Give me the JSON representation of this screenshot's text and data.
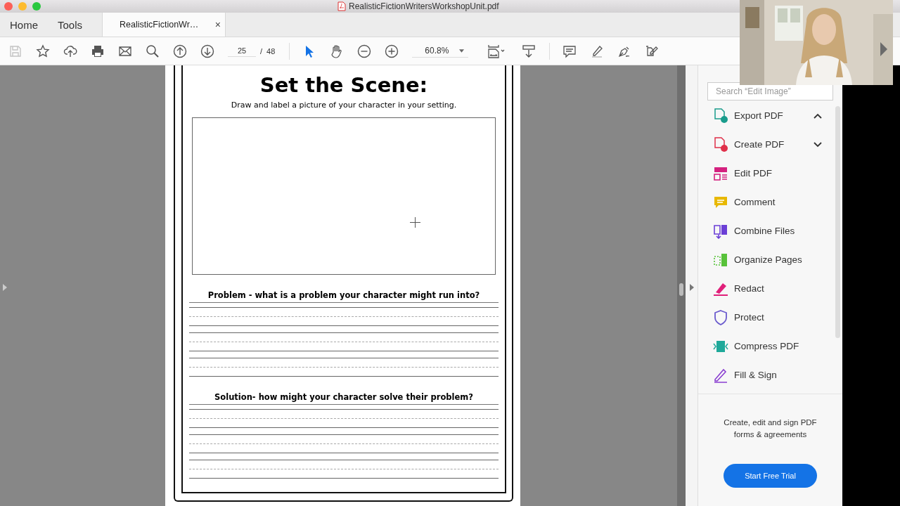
{
  "window": {
    "title": "RealisticFictionWritersWorkshopUnit.pdf"
  },
  "tabs": [
    {
      "label": "Home",
      "selected": false
    },
    {
      "label": "Tools",
      "selected": false
    },
    {
      "label": "RealisticFictionWr…",
      "selected": true,
      "close": "×"
    }
  ],
  "toolbar": {
    "file_tools": [
      {
        "kind": "save",
        "disabled": true
      },
      {
        "kind": "star",
        "disabled": false
      },
      {
        "kind": "upload",
        "disabled": false
      },
      {
        "kind": "print",
        "disabled": false
      },
      {
        "kind": "mail",
        "disabled": false
      },
      {
        "kind": "search",
        "disabled": false
      }
    ],
    "page_nav": {
      "current": "25",
      "separator": "/",
      "total": "48"
    },
    "view_tools": [
      {
        "kind": "pointer",
        "selected": true
      },
      {
        "kind": "hand",
        "selected": false
      },
      {
        "kind": "zoom-out",
        "selected": false
      },
      {
        "kind": "zoom-in",
        "selected": false
      }
    ],
    "zoom": "60.8%",
    "edit_tools": [
      {
        "kind": "fit"
      },
      {
        "kind": "scroll"
      },
      {
        "kind": "comment"
      },
      {
        "kind": "highlight"
      },
      {
        "kind": "sign"
      },
      {
        "kind": "share"
      }
    ]
  },
  "document": {
    "title": "Set the Scene:",
    "instruction": "Draw and label a picture of your character in your setting.",
    "sections": [
      {
        "heading": "**Problem** - what is a problem your character might run into?"
      },
      {
        "heading": "**Solution**- how might your character solve their problem?"
      }
    ]
  },
  "tools_panel": {
    "search": {
      "placeholder": "Search “Edit Image”"
    },
    "tools": [
      {
        "label": "Export PDF",
        "kind": "export",
        "color": "#1a9c8c",
        "expanded": true
      },
      {
        "label": "Create PDF",
        "kind": "create",
        "color": "#e0304a",
        "expanded": false
      },
      {
        "label": "Edit PDF",
        "kind": "edit",
        "color": "#d4217f"
      },
      {
        "label": "Comment",
        "kind": "comment",
        "color": "#e8b800"
      },
      {
        "label": "Combine Files",
        "kind": "combine",
        "color": "#6b3fd6"
      },
      {
        "label": "Organize Pages",
        "kind": "organize",
        "color": "#58c23a"
      },
      {
        "label": "Redact",
        "kind": "redact",
        "color": "#e0207a"
      },
      {
        "label": "Protect",
        "kind": "protect",
        "color": "#6a5acd"
      },
      {
        "label": "Compress PDF",
        "kind": "compress",
        "color": "#1fa99a"
      },
      {
        "label": "Fill & Sign",
        "kind": "sign",
        "color": "#8a3fd1"
      }
    ],
    "promo": {
      "text": "Create, edit and sign PDF forms & agreements",
      "button": "Start Free Trial"
    }
  }
}
